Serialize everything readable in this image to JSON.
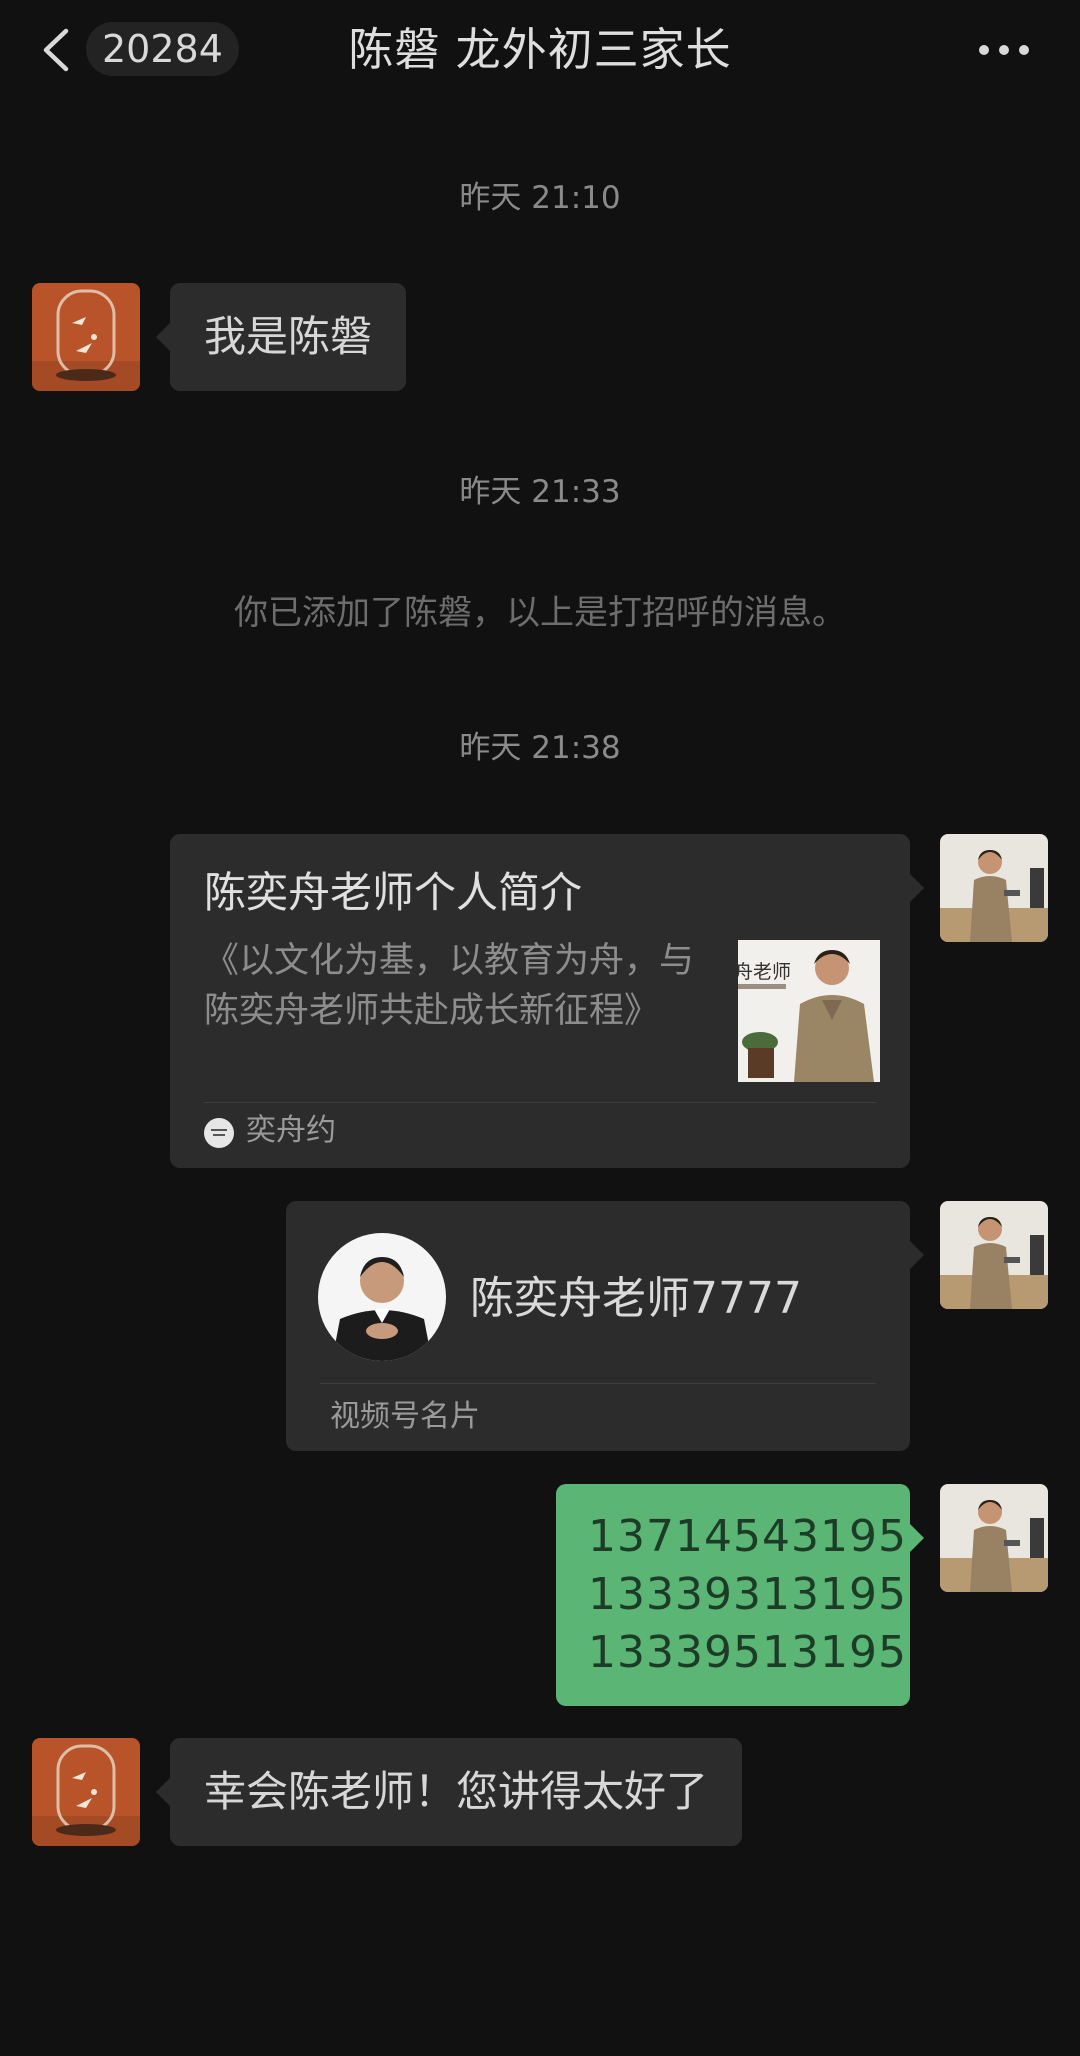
{
  "header": {
    "back_icon": "chevron-left-icon",
    "unread_count": "20284",
    "title": "陈磐 龙外初三家长",
    "more_icon": "more-dots-icon"
  },
  "messages": {
    "ts1": "昨天 21:10",
    "msg1": "我是陈磐",
    "ts2": "昨天 21:33",
    "notice": "你已添加了陈磐，以上是打招呼的消息。",
    "ts3": "昨天 21:38",
    "article": {
      "title": "陈奕舟老师个人简介",
      "desc": "《以文化为基，以教育为舟，与陈奕舟老师共赴成长新征程》",
      "thumb_text": "舟老师",
      "source": "奕舟约"
    },
    "profile_card": {
      "name": "陈奕舟老师7777",
      "label": "视频号名片"
    },
    "phones": [
      "13714543195",
      "13339313195",
      "13339513195"
    ],
    "msg_last": "幸会陈老师！您讲得太好了"
  },
  "colors": {
    "background": "#111111",
    "bubble": "#2c2c2c",
    "own_bubble": "#5bb575"
  }
}
